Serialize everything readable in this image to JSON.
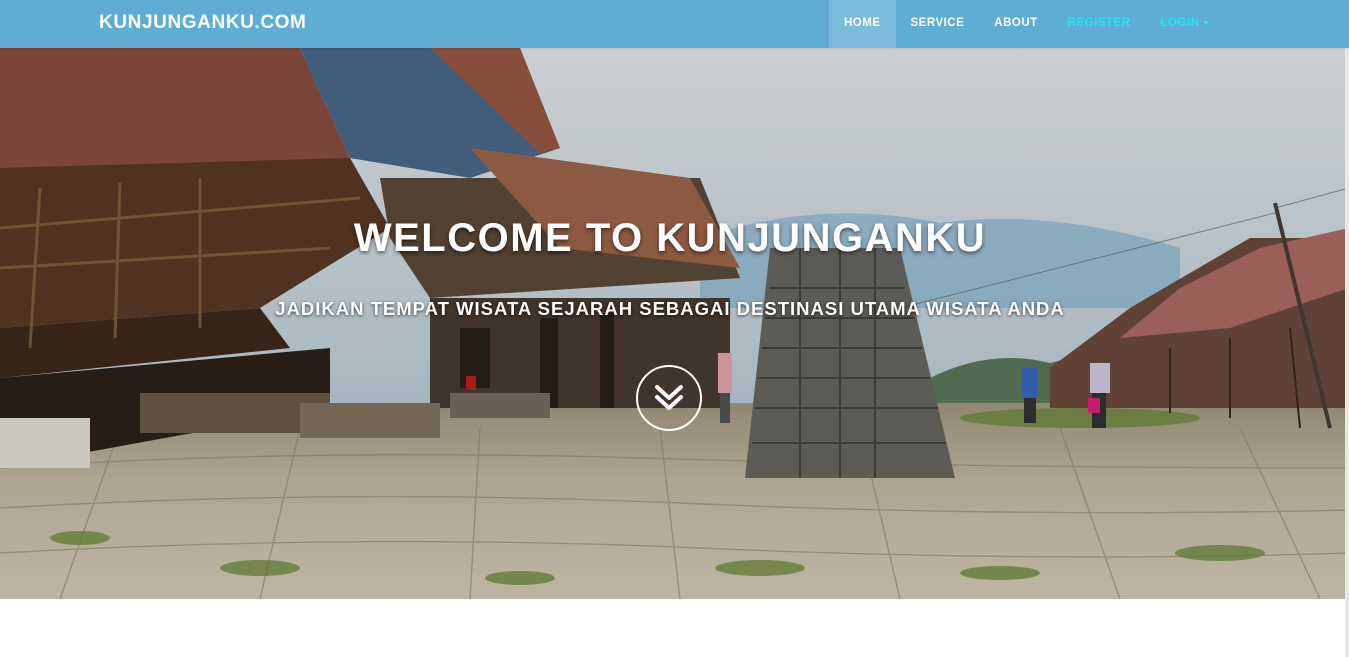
{
  "navbar": {
    "brand": "KUNJUNGANKU.COM",
    "items": [
      {
        "label": "HOME",
        "active": true
      },
      {
        "label": "SERVICE"
      },
      {
        "label": "ABOUT"
      },
      {
        "label": "REGISTER"
      },
      {
        "label": "LOGIN"
      }
    ],
    "colors": {
      "bar": "#5fadd3",
      "accent": "#22e6f2"
    }
  },
  "hero": {
    "title": "WELCOME TO KUNJUNGANKU",
    "subtitle": "JADIKAN TEMPAT WISATA SEJARAH SEBAGAI DESTINASI UTAMA WISATA ANDA",
    "scroll_icon": "double-chevron-down-icon"
  }
}
